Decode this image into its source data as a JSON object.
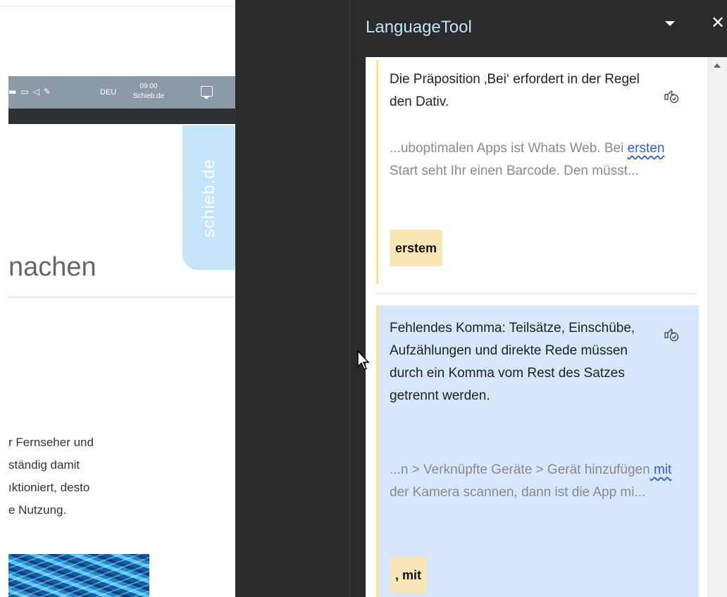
{
  "taskbar": {
    "language": "DEU",
    "time": "09:00",
    "site": "Schieb.de"
  },
  "document": {
    "side_tab": "schieb.de",
    "heading": "nachen",
    "paragraph_lines": [
      "r Fernseher und",
      "ständig damit",
      "ıktioniert, desto",
      "e Nutzung."
    ]
  },
  "pane": {
    "title": "LanguageTool",
    "accent_color": "#bfe3f7",
    "menu_icon": "dropdown-arrow",
    "close_icon": "close",
    "matches": [
      {
        "message": "Die Präposition ‚Bei‘ erfordert in der Regel den Dativ.",
        "context_before": "...uboptimalen Apps ist Whats Web. Bei ",
        "context_error": "ersten",
        "context_after": " Start seht Ihr einen Barcode. Den müsst...",
        "suggestion": "erstem",
        "icon": "ignore-rule-icon"
      },
      {
        "message": "Fehlendes Komma: Teilsätze, Einschübe, Aufzählungen und direkte Rede müssen durch ein Komma vom Rest des Satzes getrennt werden.",
        "context_before": "...n > Verknüpfte Geräte > Gerät hinzufügen",
        "context_error": " mit",
        "context_after": " der Kamera scannen, dann ist die App mi...",
        "suggestion": ", mit",
        "icon": "ignore-rule-icon"
      }
    ]
  }
}
